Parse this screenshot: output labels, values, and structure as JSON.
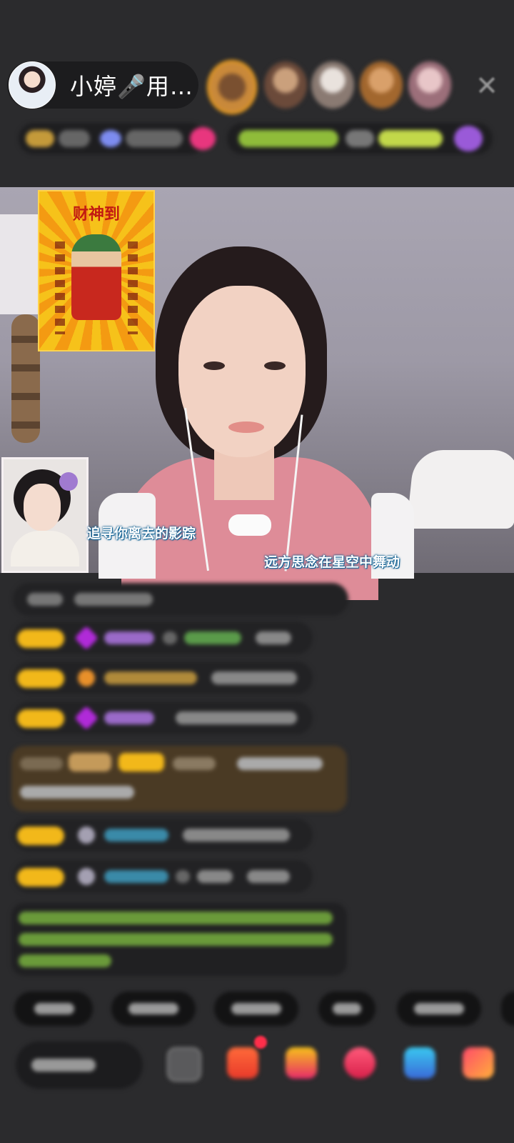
{
  "header": {
    "host_name": "小婷🎤用…",
    "close_icon": "✕"
  },
  "video": {
    "poster_title": "财神到",
    "lyric_left": "追寻你离去的影踪",
    "lyric_right": "远方思念在星空中舞动"
  },
  "colors": {
    "background": "#2b2b2d",
    "poster_yellow": "#f6c21a",
    "badge_yellow": "#f2b81a",
    "gem_purple": "#b02ad8",
    "lyric_glow": "#0a5a8c"
  },
  "icons": [
    "close-icon",
    "chat-icon",
    "gift-box-icon",
    "treasure-icon",
    "heart-icon",
    "gamepad-icon",
    "apps-icon"
  ]
}
